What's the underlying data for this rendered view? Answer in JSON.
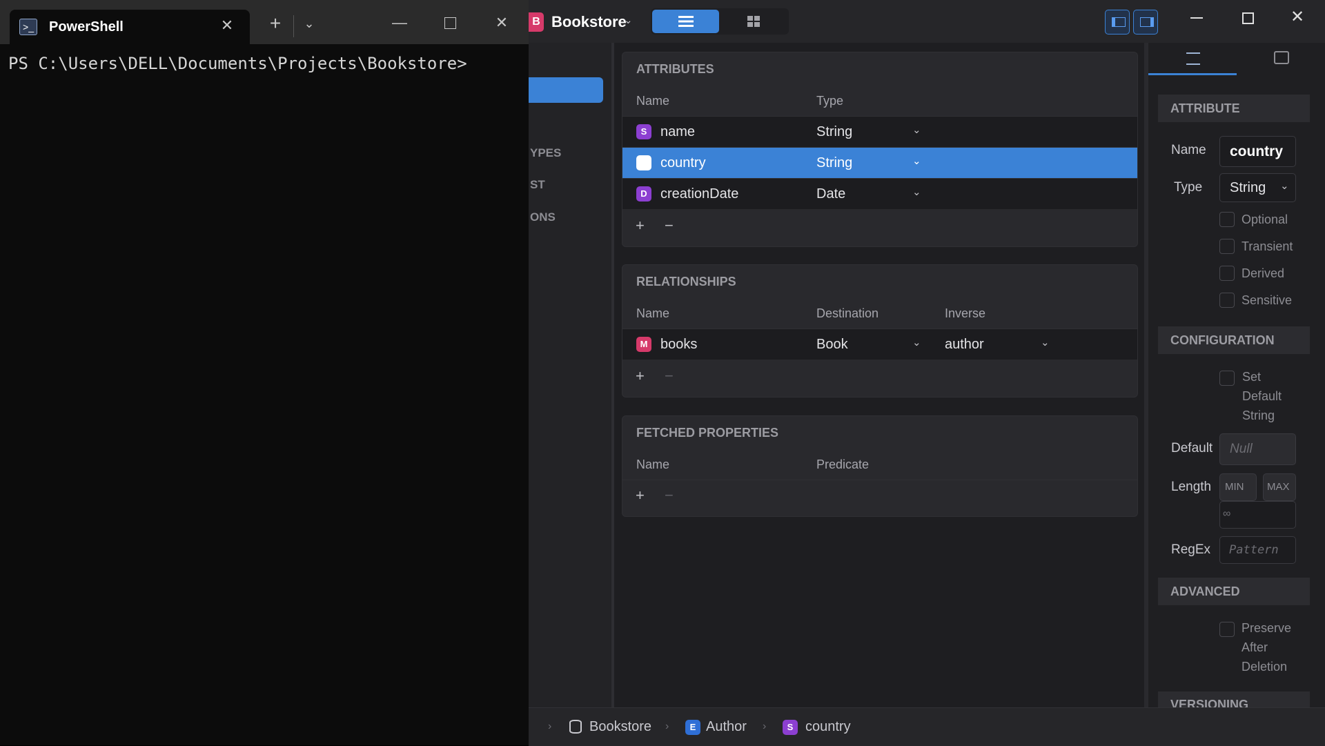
{
  "terminal": {
    "tab_title": "PowerShell",
    "prompt": "PS C:\\Users\\DELL\\Documents\\Projects\\Bookstore>"
  },
  "app": {
    "project_name": "Bookstore",
    "project_badge": "B",
    "sidebar": {
      "partial_labels": [
        "YPES",
        "ST",
        "ONS"
      ]
    },
    "attributes": {
      "title": "ATTRIBUTES",
      "columns": [
        "Name",
        "Type"
      ],
      "rows": [
        {
          "badge": "S",
          "name": "name",
          "type": "String"
        },
        {
          "badge": "",
          "name": "country",
          "type": "String",
          "selected": true
        },
        {
          "badge": "D",
          "name": "creationDate",
          "type": "Date"
        }
      ]
    },
    "relationships": {
      "title": "RELATIONSHIPS",
      "columns": [
        "Name",
        "Destination",
        "Inverse"
      ],
      "rows": [
        {
          "badge": "M",
          "name": "books",
          "destination": "Book",
          "inverse": "author"
        }
      ]
    },
    "fetched": {
      "title": "FETCHED PROPERTIES",
      "columns": [
        "Name",
        "Predicate"
      ]
    },
    "add_label": "+",
    "remove_label": "−",
    "inspector": {
      "attribute_title": "ATTRIBUTE",
      "name_label": "Name",
      "name_value": "country",
      "type_label": "Type",
      "type_value": "String",
      "checkboxes": [
        "Optional",
        "Transient",
        "Derived",
        "Sensitive"
      ],
      "configuration_title": "CONFIGURATION",
      "set_default_lines": [
        "Set",
        "Default",
        "String"
      ],
      "default_label": "Default",
      "default_placeholder": "Null",
      "length_label": "Length",
      "min_placeholder": "MIN",
      "max_placeholder": "MAX",
      "infinity": "∞",
      "regex_label": "RegEx",
      "regex_placeholder": "Pattern",
      "advanced_title": "ADVANCED",
      "preserve_lines": [
        "Preserve",
        "After",
        "Deletion"
      ],
      "versioning_title": "VERSIONING"
    },
    "breadcrumb": {
      "items": [
        {
          "badge": "",
          "label": "Bookstore"
        },
        {
          "badge": "E",
          "label": "Author"
        },
        {
          "badge": "S",
          "label": "country"
        }
      ]
    }
  },
  "colors": {
    "accent": "#3b82d6",
    "badge_pink": "#d63a6a",
    "badge_purple": "#8c3fd1",
    "badge_blue": "#2f6fd6"
  }
}
